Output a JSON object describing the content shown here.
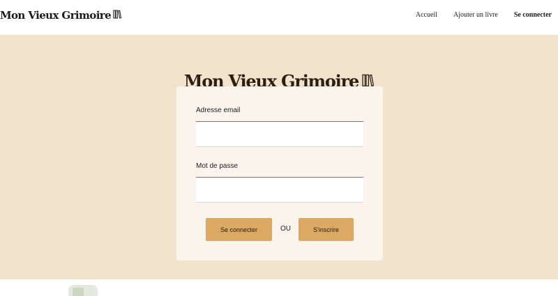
{
  "header": {
    "brand": "Mon Vieux Grimoire",
    "brand_icon": "book-icon",
    "nav": [
      {
        "label": "Accueil"
      },
      {
        "label": "Ajouter un livre"
      },
      {
        "label": "Se connecter"
      }
    ]
  },
  "hero": {
    "title": "Mon Vieux Grimoire",
    "title_icon": "book-icon"
  },
  "login_form": {
    "email_label": "Adresse email",
    "email_value": "",
    "password_label": "Mot de passe",
    "password_value": "",
    "login_button": "Se connecter",
    "separator": "OU",
    "signup_button": "S'inscrire"
  },
  "colors": {
    "hero_background": "#f2e3cd",
    "card_background": "#faf4ec",
    "button_background": "#dba964",
    "header_background": "#ffffff"
  }
}
